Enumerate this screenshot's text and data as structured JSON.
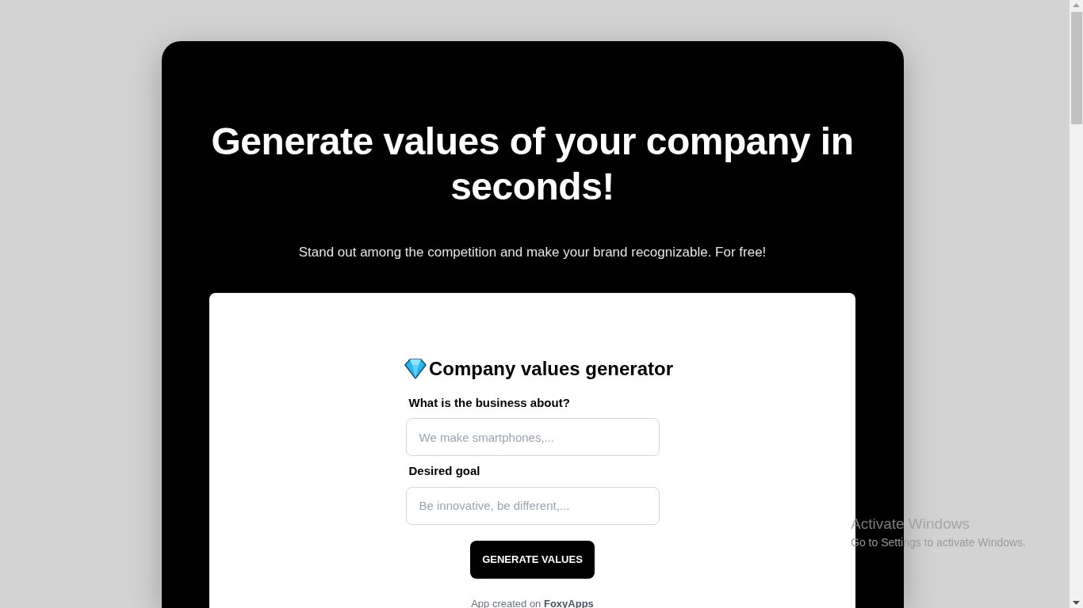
{
  "hero": {
    "title": "Generate values of your company in seconds!",
    "subtitle": "Stand out among the competition and make your brand recognizable. For free!"
  },
  "form": {
    "title": "Company values generator",
    "fields": [
      {
        "label": "What is the business about?",
        "placeholder": "We make smartphones,..."
      },
      {
        "label": "Desired goal",
        "placeholder": "Be innovative, be different,..."
      }
    ],
    "button": "GENERATE VALUES",
    "footer": "App created on **FoxyApps**"
  },
  "os_notice": {
    "title": "Activate Windows",
    "text": "Go to Settings to activate Windows."
  }
}
